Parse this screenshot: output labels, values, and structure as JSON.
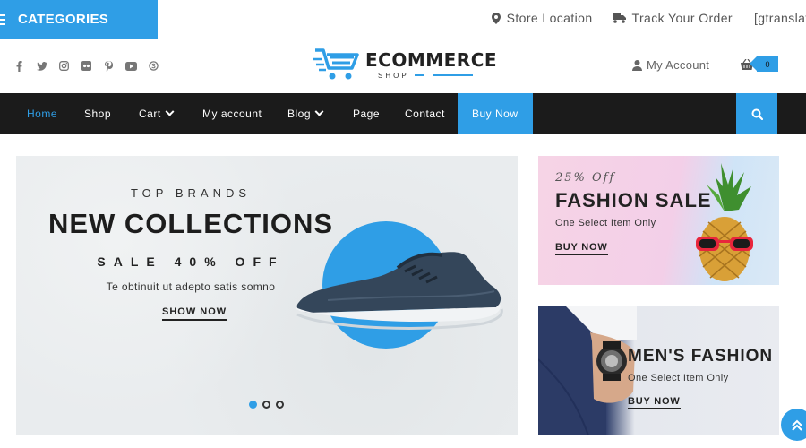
{
  "topbar": {
    "categories_label": "CATEGORIES",
    "links": {
      "store_location": "Store Location",
      "track_order": "Track Your Order",
      "gtranslate": "[gtranslate]"
    }
  },
  "social_icons": [
    "facebook-icon",
    "twitter-icon",
    "instagram-icon",
    "flickr-icon",
    "pinterest-icon",
    "youtube-icon",
    "skype-icon"
  ],
  "logo": {
    "title": "ECOMMERCE",
    "subtitle": "SHOP"
  },
  "account": {
    "label": "My Account",
    "cart_count": "0"
  },
  "nav": {
    "home": "Home",
    "shop": "Shop",
    "cart": "Cart",
    "my_account": "My account",
    "blog": "Blog",
    "page": "Page",
    "contact": "Contact",
    "buy_now": "Buy Now"
  },
  "hero": {
    "kicker": "TOP BRANDS",
    "title": "NEW COLLECTIONS",
    "sale": "SALE 40% OFF",
    "subtitle": "Te obtinuit ut adepto satis somno",
    "cta": "SHOW NOW",
    "active_slide": 1,
    "slide_count": 3
  },
  "banner_fashion": {
    "script": "25% Off",
    "heading": "FASHION SALE",
    "subtitle": "One Select Item Only",
    "cta": "BUY NOW"
  },
  "banner_men": {
    "heading": "MEN'S FASHION",
    "subtitle": "One Select Item Only",
    "cta": "BUY NOW"
  },
  "colors": {
    "accent": "#2f9ee6",
    "nav_bg": "#1b1b1b"
  }
}
